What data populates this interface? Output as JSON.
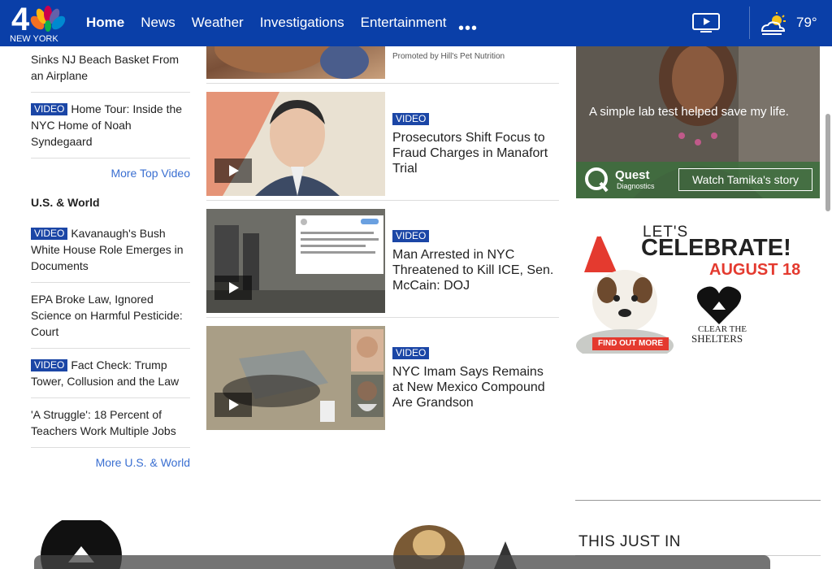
{
  "header": {
    "logo_number": "4",
    "logo_text": "NEW YORK",
    "nav": [
      {
        "label": "Home",
        "active": true
      },
      {
        "label": "News"
      },
      {
        "label": "Weather"
      },
      {
        "label": "Investigations"
      },
      {
        "label": "Entertainment"
      }
    ],
    "more_dots": "•••",
    "temperature": "79°",
    "icons": [
      "nbc-peacock-icon",
      "tv-play-icon",
      "partly-cloudy-icon",
      "more-dots-icon"
    ],
    "colors": {
      "brand": "#0a3fa8",
      "badge": "#1b46a6",
      "link": "#3a6fd1"
    }
  },
  "left": {
    "top_video_items": [
      {
        "badge": "",
        "title": "Sinks NJ Beach Basket From an Airplane"
      },
      {
        "badge": "VIDEO",
        "title": "Home Tour: Inside the NYC Home of Noah Syndegaard"
      }
    ],
    "more_top_video": "More Top Video",
    "us_world_title": "U.S. & World",
    "us_world_items": [
      {
        "badge": "VIDEO",
        "title": "Kavanaugh's Bush White House Role Emerges in Documents"
      },
      {
        "badge": "",
        "title": "EPA Broke Law, Ignored Science on Harmful Pesticide: Court"
      },
      {
        "badge": "VIDEO",
        "title": "Fact Check: Trump Tower, Collusion and the Law"
      },
      {
        "badge": "",
        "title": "'A Struggle': 18 Percent of Teachers Work Multiple Jobs"
      }
    ],
    "more_us_world": "More U.S. & World"
  },
  "middle": {
    "promoted": "Promoted by Hill's Pet Nutrition",
    "stories": [
      {
        "badge": "VIDEO",
        "title": "Prosecutors Shift Focus to Fraud Charges in Manafort Trial"
      },
      {
        "badge": "VIDEO",
        "title": "Man Arrested in NYC Threatened to Kill ICE, Sen. McCain: DOJ"
      },
      {
        "badge": "VIDEO",
        "title": "NYC Imam Says Remains at New Mexico Compound Are Grandson"
      }
    ]
  },
  "right": {
    "ad1_text": "A simple lab test helped save my life.",
    "ad1_brand": "Quest",
    "ad1_brand_sub": "Diagnostics",
    "ad1_cta": "Watch Tamika's story",
    "ad2_lets": "LET'S",
    "ad2_celebrate": "CELEBRATE!",
    "ad2_date": "AUGUST 18",
    "ad2_cta": "FIND OUT MORE",
    "ad2_brand_top": "CLEAR THE",
    "ad2_brand_bottom": "SHELTERS",
    "this_just_in": "THIS JUST IN"
  }
}
